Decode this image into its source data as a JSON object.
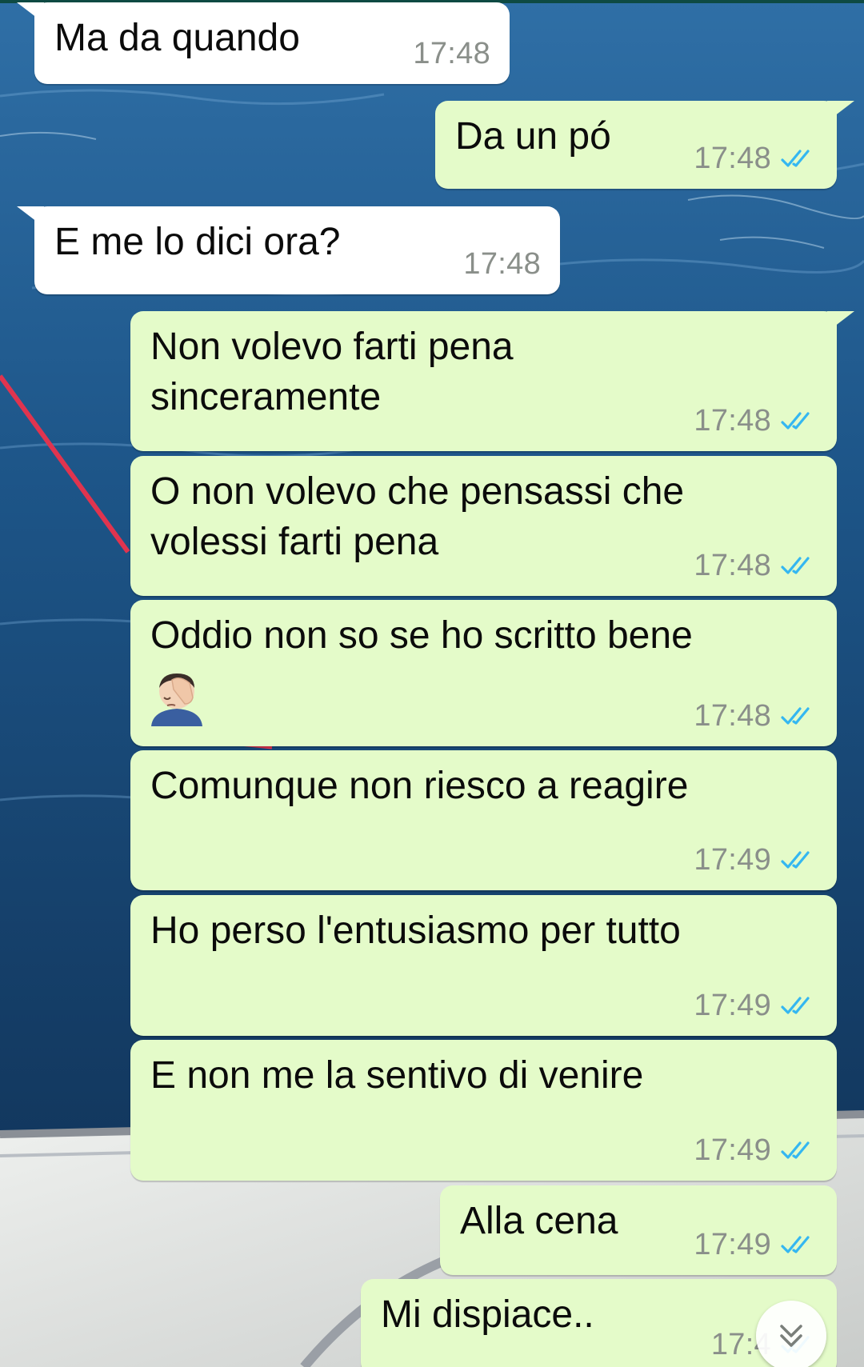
{
  "colors": {
    "incoming_bubble": "#ffffff",
    "outgoing_bubble": "#e4fbc9",
    "read_tick": "#34b7f1",
    "timestamp": "#8a8f8a"
  },
  "messages": [
    {
      "direction": "incoming",
      "text": "Ma da quando",
      "time": "17:48"
    },
    {
      "direction": "outgoing",
      "text": "Da un pó",
      "time": "17:48",
      "status": "read"
    },
    {
      "direction": "incoming",
      "text": "E me lo dici ora?",
      "time": "17:48"
    },
    {
      "direction": "outgoing",
      "text": "Non volevo farti pena\nsinceramente",
      "time": "17:48",
      "status": "read"
    },
    {
      "direction": "outgoing",
      "text": "O non volevo che pensassi che\nvolessi farti pena",
      "time": "17:48",
      "status": "read"
    },
    {
      "direction": "outgoing",
      "text": "Oddio non so se ho scritto bene",
      "emoji": "man-facepalming-icon",
      "time": "17:48",
      "status": "read"
    },
    {
      "direction": "outgoing",
      "text": "Comunque non riesco a reagire",
      "time": "17:49",
      "status": "read"
    },
    {
      "direction": "outgoing",
      "text": "Ho perso l'entusiasmo per tutto",
      "time": "17:49",
      "status": "read"
    },
    {
      "direction": "outgoing",
      "text": "E non me la sentivo di venire",
      "time": "17:49",
      "status": "read"
    },
    {
      "direction": "outgoing",
      "text": "Alla cena",
      "time": "17:49",
      "status": "read"
    },
    {
      "direction": "outgoing",
      "text": "Mi dispiace..",
      "time": "17:4",
      "status": "read"
    }
  ],
  "scroll_button": {
    "icon": "double-chevron-down-icon"
  }
}
